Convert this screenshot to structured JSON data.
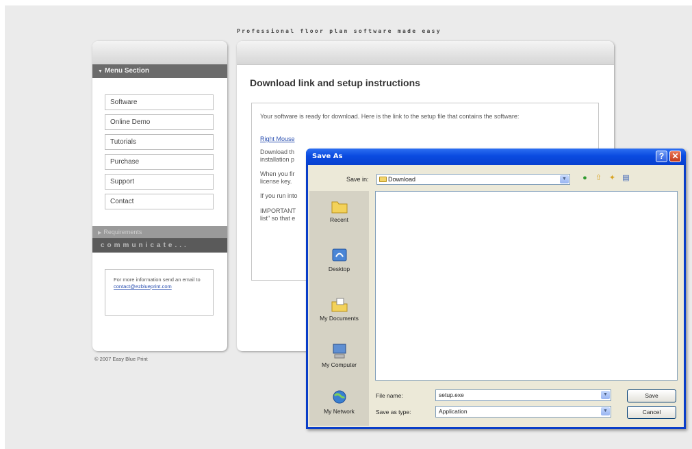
{
  "site": {
    "tagline": "Professional floor plan software made easy",
    "copyright": "© 2007 Easy Blue Print"
  },
  "sidebar": {
    "menu_header": "Menu Section",
    "items": [
      {
        "label": "Software"
      },
      {
        "label": "Online Demo"
      },
      {
        "label": "Tutorials"
      },
      {
        "label": "Purchase"
      },
      {
        "label": "Support"
      },
      {
        "label": "Contact"
      }
    ],
    "requirements_header": "Requirements",
    "communicate_header": "communicate...",
    "info_text": "For more information send an email to",
    "info_email": "contact@ezblueprint.com"
  },
  "main": {
    "title": "Download link and setup instructions",
    "p1": "Your software is ready for download. Here is the link to the setup file that contains the software:",
    "link_text": "Right Mouse",
    "p2": "Download th",
    "p2b": "installation p",
    "p3": "When you fir",
    "p3b": "license key.",
    "p4": "If you run into",
    "p5": "IMPORTANT",
    "p5b": "list\" so that e"
  },
  "dialog": {
    "title": "Save As",
    "help_glyph": "?",
    "close_glyph": "✕",
    "save_in_label": "Save in:",
    "save_in_value": "Download",
    "places": [
      {
        "label": "Recent",
        "icon": "recent-folder-icon"
      },
      {
        "label": "Desktop",
        "icon": "desktop-icon"
      },
      {
        "label": "My Documents",
        "icon": "my-documents-icon"
      },
      {
        "label": "My Computer",
        "icon": "my-computer-icon"
      },
      {
        "label": "My Network",
        "icon": "my-network-icon"
      }
    ],
    "file_name_label": "File name:",
    "file_name_value": "setup.exe",
    "save_type_label": "Save as type:",
    "save_type_value": "Application",
    "save_button": "Save",
    "cancel_button": "Cancel"
  }
}
